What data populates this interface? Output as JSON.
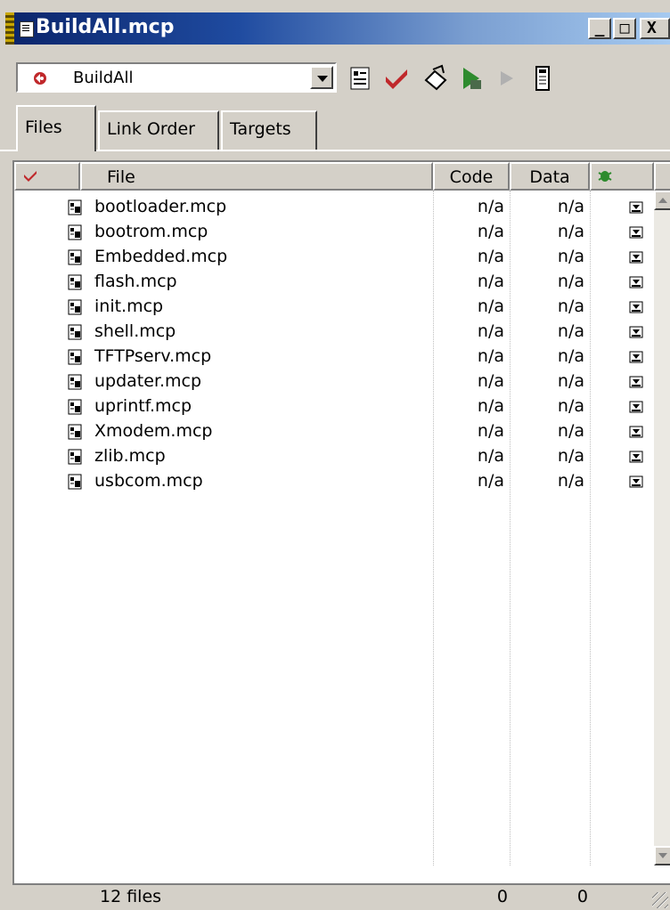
{
  "window": {
    "title": "BuildAll.mcp"
  },
  "title_buttons": {
    "minimize": "_",
    "maximize": "□",
    "close": "X"
  },
  "toolbar": {
    "target": "BuildAll",
    "tools": [
      "settings-icon",
      "check-icon",
      "compile-icon",
      "make-icon",
      "run-icon",
      "debug-info-icon"
    ]
  },
  "tabs": [
    {
      "label": "Files",
      "active": true
    },
    {
      "label": "Link Order",
      "active": false
    },
    {
      "label": "Targets",
      "active": false
    }
  ],
  "columns": {
    "file": "File",
    "code": "Code",
    "data": "Data"
  },
  "files": [
    {
      "name": "bootloader.mcp",
      "code": "n/a",
      "data": "n/a"
    },
    {
      "name": "bootrom.mcp",
      "code": "n/a",
      "data": "n/a"
    },
    {
      "name": "Embedded.mcp",
      "code": "n/a",
      "data": "n/a"
    },
    {
      "name": "flash.mcp",
      "code": "n/a",
      "data": "n/a"
    },
    {
      "name": "init.mcp",
      "code": "n/a",
      "data": "n/a"
    },
    {
      "name": "shell.mcp",
      "code": "n/a",
      "data": "n/a"
    },
    {
      "name": "TFTPserv.mcp",
      "code": "n/a",
      "data": "n/a"
    },
    {
      "name": "updater.mcp",
      "code": "n/a",
      "data": "n/a"
    },
    {
      "name": "uprintf.mcp",
      "code": "n/a",
      "data": "n/a"
    },
    {
      "name": "Xmodem.mcp",
      "code": "n/a",
      "data": "n/a"
    },
    {
      "name": "zlib.mcp",
      "code": "n/a",
      "data": "n/a"
    },
    {
      "name": "usbcom.mcp",
      "code": "n/a",
      "data": "n/a"
    }
  ],
  "footer": {
    "count": "12 files",
    "code_total": "0",
    "data_total": "0"
  },
  "colors": {
    "title_start": "#0a246a",
    "title_end": "#a6caf0",
    "face": "#d4d0c8",
    "check_red": "#c0282b",
    "bug_green": "#2e8b2e"
  }
}
